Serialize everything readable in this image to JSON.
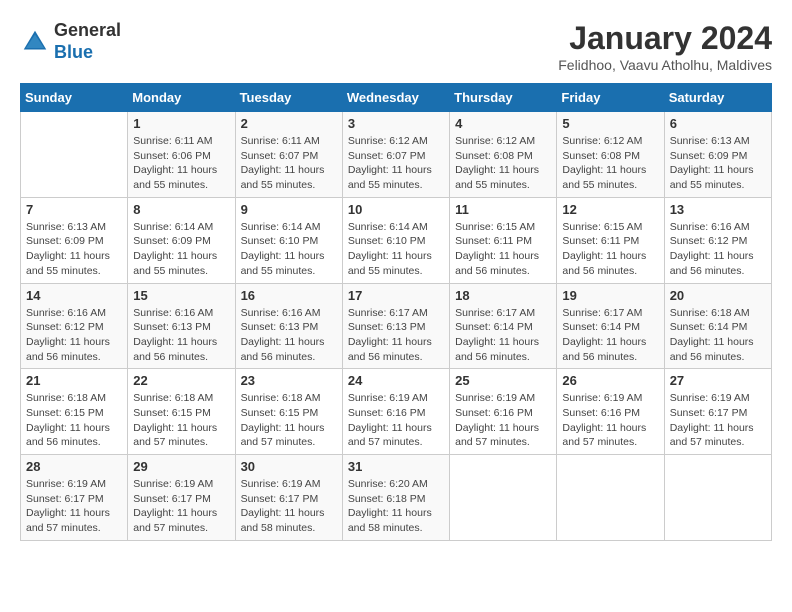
{
  "logo": {
    "general": "General",
    "blue": "Blue"
  },
  "title": "January 2024",
  "subtitle": "Felidhoo, Vaavu Atholhu, Maldives",
  "weekdays": [
    "Sunday",
    "Monday",
    "Tuesday",
    "Wednesday",
    "Thursday",
    "Friday",
    "Saturday"
  ],
  "weeks": [
    [
      {
        "day": "",
        "info": ""
      },
      {
        "day": "1",
        "info": "Sunrise: 6:11 AM\nSunset: 6:06 PM\nDaylight: 11 hours\nand 55 minutes."
      },
      {
        "day": "2",
        "info": "Sunrise: 6:11 AM\nSunset: 6:07 PM\nDaylight: 11 hours\nand 55 minutes."
      },
      {
        "day": "3",
        "info": "Sunrise: 6:12 AM\nSunset: 6:07 PM\nDaylight: 11 hours\nand 55 minutes."
      },
      {
        "day": "4",
        "info": "Sunrise: 6:12 AM\nSunset: 6:08 PM\nDaylight: 11 hours\nand 55 minutes."
      },
      {
        "day": "5",
        "info": "Sunrise: 6:12 AM\nSunset: 6:08 PM\nDaylight: 11 hours\nand 55 minutes."
      },
      {
        "day": "6",
        "info": "Sunrise: 6:13 AM\nSunset: 6:09 PM\nDaylight: 11 hours\nand 55 minutes."
      }
    ],
    [
      {
        "day": "7",
        "info": "Sunrise: 6:13 AM\nSunset: 6:09 PM\nDaylight: 11 hours\nand 55 minutes."
      },
      {
        "day": "8",
        "info": "Sunrise: 6:14 AM\nSunset: 6:09 PM\nDaylight: 11 hours\nand 55 minutes."
      },
      {
        "day": "9",
        "info": "Sunrise: 6:14 AM\nSunset: 6:10 PM\nDaylight: 11 hours\nand 55 minutes."
      },
      {
        "day": "10",
        "info": "Sunrise: 6:14 AM\nSunset: 6:10 PM\nDaylight: 11 hours\nand 55 minutes."
      },
      {
        "day": "11",
        "info": "Sunrise: 6:15 AM\nSunset: 6:11 PM\nDaylight: 11 hours\nand 56 minutes."
      },
      {
        "day": "12",
        "info": "Sunrise: 6:15 AM\nSunset: 6:11 PM\nDaylight: 11 hours\nand 56 minutes."
      },
      {
        "day": "13",
        "info": "Sunrise: 6:16 AM\nSunset: 6:12 PM\nDaylight: 11 hours\nand 56 minutes."
      }
    ],
    [
      {
        "day": "14",
        "info": "Sunrise: 6:16 AM\nSunset: 6:12 PM\nDaylight: 11 hours\nand 56 minutes."
      },
      {
        "day": "15",
        "info": "Sunrise: 6:16 AM\nSunset: 6:13 PM\nDaylight: 11 hours\nand 56 minutes."
      },
      {
        "day": "16",
        "info": "Sunrise: 6:16 AM\nSunset: 6:13 PM\nDaylight: 11 hours\nand 56 minutes."
      },
      {
        "day": "17",
        "info": "Sunrise: 6:17 AM\nSunset: 6:13 PM\nDaylight: 11 hours\nand 56 minutes."
      },
      {
        "day": "18",
        "info": "Sunrise: 6:17 AM\nSunset: 6:14 PM\nDaylight: 11 hours\nand 56 minutes."
      },
      {
        "day": "19",
        "info": "Sunrise: 6:17 AM\nSunset: 6:14 PM\nDaylight: 11 hours\nand 56 minutes."
      },
      {
        "day": "20",
        "info": "Sunrise: 6:18 AM\nSunset: 6:14 PM\nDaylight: 11 hours\nand 56 minutes."
      }
    ],
    [
      {
        "day": "21",
        "info": "Sunrise: 6:18 AM\nSunset: 6:15 PM\nDaylight: 11 hours\nand 56 minutes."
      },
      {
        "day": "22",
        "info": "Sunrise: 6:18 AM\nSunset: 6:15 PM\nDaylight: 11 hours\nand 57 minutes."
      },
      {
        "day": "23",
        "info": "Sunrise: 6:18 AM\nSunset: 6:15 PM\nDaylight: 11 hours\nand 57 minutes."
      },
      {
        "day": "24",
        "info": "Sunrise: 6:19 AM\nSunset: 6:16 PM\nDaylight: 11 hours\nand 57 minutes."
      },
      {
        "day": "25",
        "info": "Sunrise: 6:19 AM\nSunset: 6:16 PM\nDaylight: 11 hours\nand 57 minutes."
      },
      {
        "day": "26",
        "info": "Sunrise: 6:19 AM\nSunset: 6:16 PM\nDaylight: 11 hours\nand 57 minutes."
      },
      {
        "day": "27",
        "info": "Sunrise: 6:19 AM\nSunset: 6:17 PM\nDaylight: 11 hours\nand 57 minutes."
      }
    ],
    [
      {
        "day": "28",
        "info": "Sunrise: 6:19 AM\nSunset: 6:17 PM\nDaylight: 11 hours\nand 57 minutes."
      },
      {
        "day": "29",
        "info": "Sunrise: 6:19 AM\nSunset: 6:17 PM\nDaylight: 11 hours\nand 57 minutes."
      },
      {
        "day": "30",
        "info": "Sunrise: 6:19 AM\nSunset: 6:17 PM\nDaylight: 11 hours\nand 58 minutes."
      },
      {
        "day": "31",
        "info": "Sunrise: 6:20 AM\nSunset: 6:18 PM\nDaylight: 11 hours\nand 58 minutes."
      },
      {
        "day": "",
        "info": ""
      },
      {
        "day": "",
        "info": ""
      },
      {
        "day": "",
        "info": ""
      }
    ]
  ]
}
